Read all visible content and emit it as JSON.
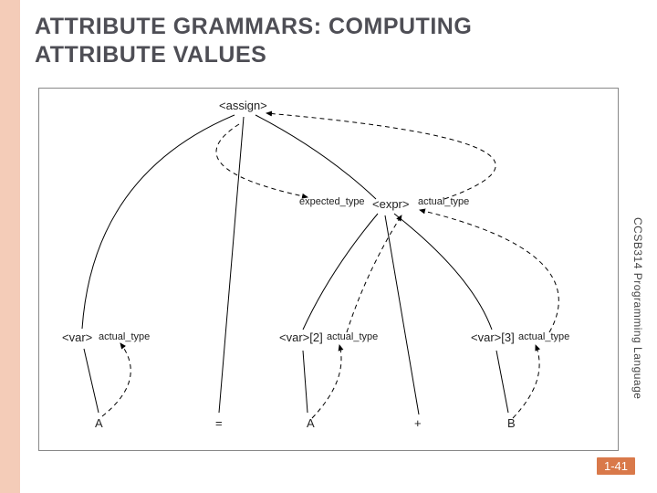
{
  "title_line1": "ATTRIBUTE GRAMMARS: COMPUTING",
  "title_line2": "ATTRIBUTE VALUES",
  "course": "CCSB314 Programming Language",
  "slide_number": "1-41",
  "diagram": {
    "assign": "<assign>",
    "expected_type": "expected_type",
    "expr": "<expr>",
    "actual_type_expr": "actual_type",
    "var1": "<var>",
    "actual_type_var1": "actual_type",
    "var2": "<var>[2]",
    "actual_type_var2": "actual_type",
    "var3": "<var>[3]",
    "actual_type_var3": "actual_type",
    "terminal_A1": "A",
    "terminal_eq": "=",
    "terminal_A2": "A",
    "terminal_plus": "+",
    "terminal_B": "B"
  }
}
